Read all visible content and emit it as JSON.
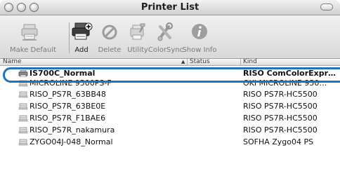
{
  "window": {
    "title": "Printer List"
  },
  "toolbar": {
    "items": [
      {
        "label": "Make Default",
        "icon": "make-default-icon",
        "enabled": false
      },
      {
        "label": "Add",
        "icon": "add-printer-icon",
        "enabled": true
      },
      {
        "label": "Delete",
        "icon": "delete-icon",
        "enabled": false
      },
      {
        "label": "Utility",
        "icon": "utility-icon",
        "enabled": false
      },
      {
        "label": "ColorSync",
        "icon": "colorsync-icon",
        "enabled": false
      },
      {
        "label": "Show Info",
        "icon": "info-icon",
        "enabled": false
      }
    ]
  },
  "columns": {
    "name": "Name",
    "status": "Status",
    "kind": "Kind"
  },
  "printers": [
    {
      "name": "IS700C_Normal",
      "kind": "RISO ComColorExpr…",
      "selected": true
    },
    {
      "name": "MICROLINE 9500PS-F",
      "kind": "OKI MICROLINE 950…",
      "selected": false
    },
    {
      "name": "RISO_PS7R_63BB48",
      "kind": "RISO PS7R-HC5500",
      "selected": false
    },
    {
      "name": "RISO_PS7R_63BE0E",
      "kind": "RISO PS7R-HC5500",
      "selected": false
    },
    {
      "name": "RISO_PS7R_F1BAE6",
      "kind": "RISO PS7R-HC5500",
      "selected": false
    },
    {
      "name": "RISO_PS7R_nakamura",
      "kind": "RISO PS7R-HC5500",
      "selected": false
    },
    {
      "name": "ZYGO04J-048_Normal",
      "kind": "SOFHA Zygo04 PS",
      "selected": false
    }
  ],
  "colors": {
    "highlight": "#1f73b8"
  }
}
